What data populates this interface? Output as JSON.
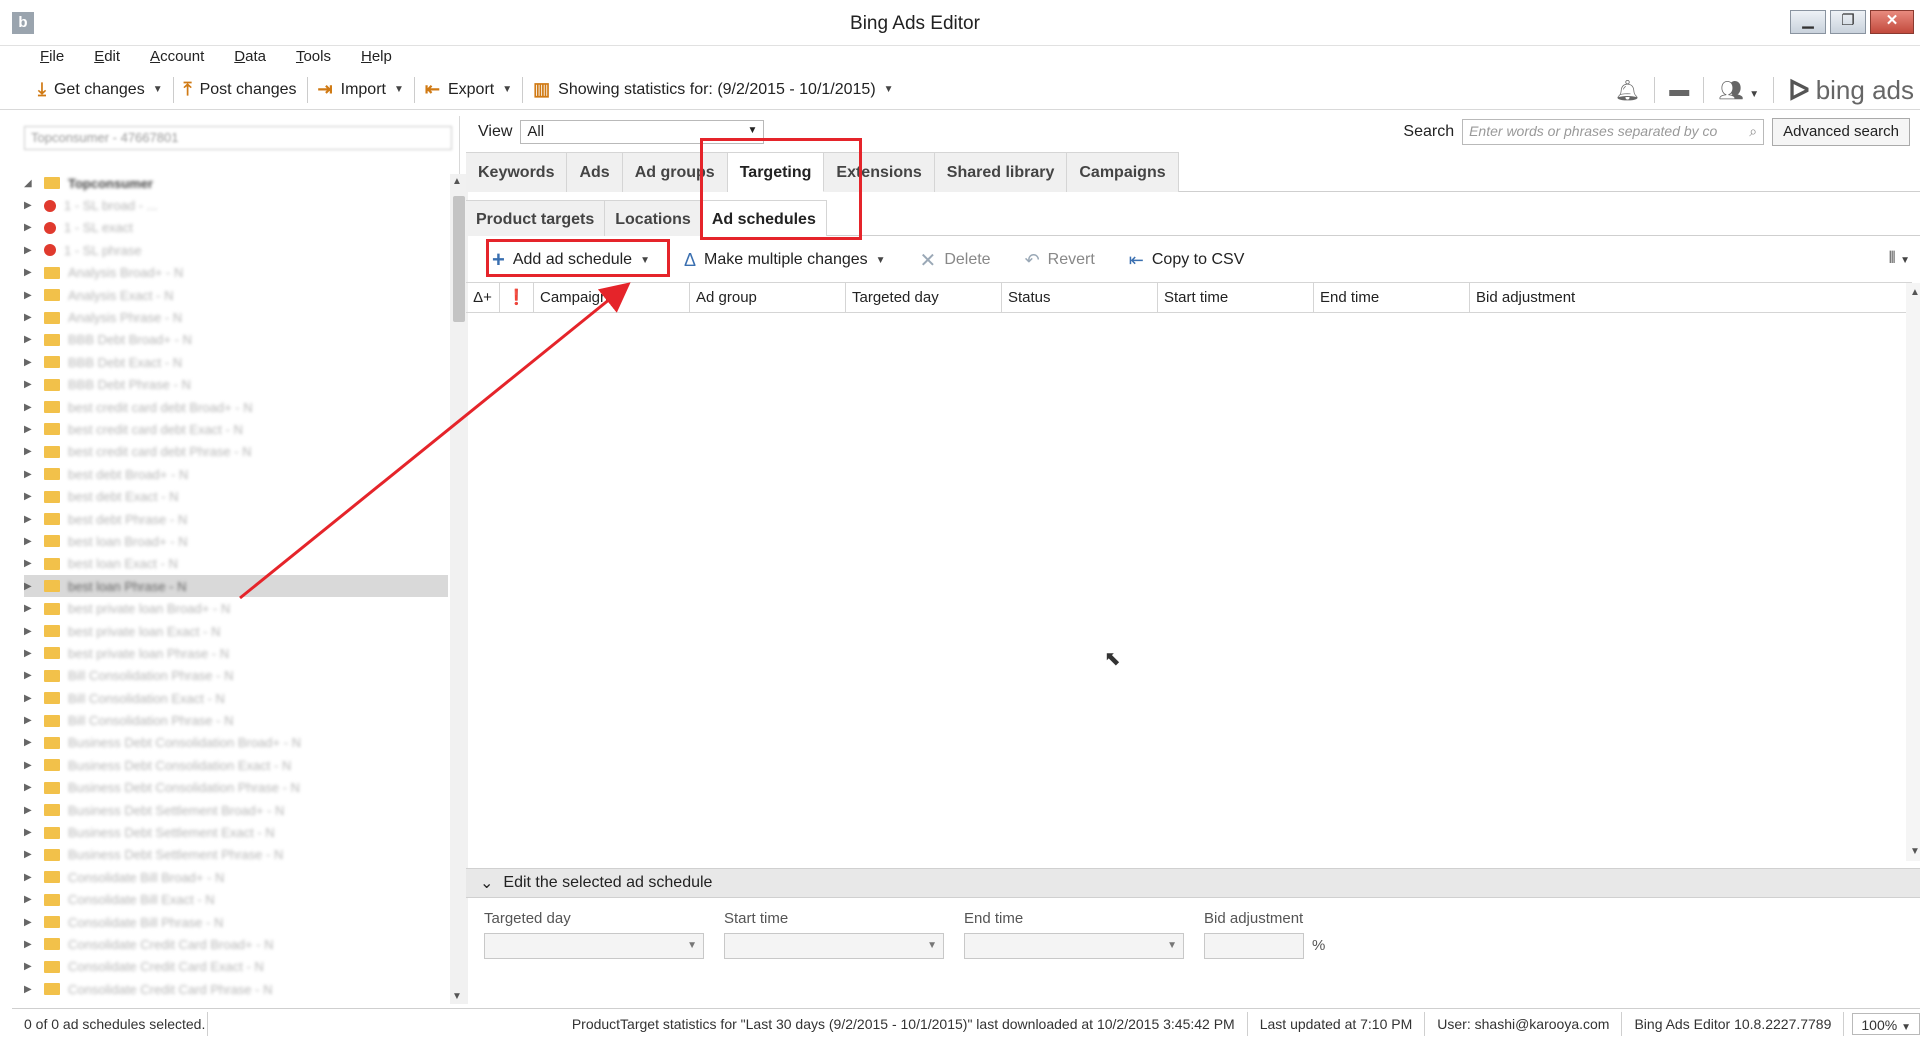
{
  "window": {
    "title": "Bing Ads Editor",
    "logo": "b"
  },
  "menu": [
    {
      "pre": "",
      "u": "F",
      "post": "ile"
    },
    {
      "pre": "",
      "u": "E",
      "post": "dit"
    },
    {
      "pre": "",
      "u": "A",
      "post": "ccount"
    },
    {
      "pre": "",
      "u": "D",
      "post": "ata"
    },
    {
      "pre": "",
      "u": "T",
      "post": "ools"
    },
    {
      "pre": "",
      "u": "H",
      "post": "elp"
    }
  ],
  "toolbar": {
    "get_changes": "Get changes",
    "post_changes": "Post changes",
    "import": "Import",
    "export": "Export",
    "stats": "Showing statistics for: (9/2/2015 - 10/1/2015)",
    "brand": "bing ads"
  },
  "left": {
    "account_field": "Topconsumer - 47667801",
    "root": "Topconsumer",
    "tree": [
      "1 - SL broad - ...",
      "1 - SL exact",
      "1 - SL phrase",
      "Analysis Broad+ - N",
      "Analysis Exact - N",
      "Analysis Phrase - N",
      "BBB Debt Broad+ - N",
      "BBB Debt Exact - N",
      "BBB Debt Phrase - N",
      "best credit card debt Broad+ - N",
      "best credit card debt Exact - N",
      "best credit card debt Phrase - N",
      "best debt Broad+ - N",
      "best debt Exact - N",
      "best debt Phrase - N",
      "best loan Broad+ - N",
      "best loan Exact - N",
      "best loan Phrase - N",
      "best private loan Broad+ - N",
      "best private loan Exact - N",
      "best private loan Phrase - N",
      "Bill Consolidation Phrase - N",
      "Bill Consolidation Exact - N",
      "Bill Consolidation Phrase - N",
      "Business Debt Consolidation Broad+ - N",
      "Business Debt Consolidation Exact - N",
      "Business Debt Consolidation Phrase - N",
      "Business Debt Settlement Broad+ - N",
      "Business Debt Settlement Exact - N",
      "Business Debt Settlement Phrase - N",
      "Consolidate Bill Broad+ - N",
      "Consolidate Bill Exact - N",
      "Consolidate Bill Phrase - N",
      "Consolidate Credit Card Broad+ - N",
      "Consolidate Credit Card Exact - N",
      "Consolidate Credit Card Phrase - N"
    ]
  },
  "main": {
    "view_label": "View",
    "view_value": "All",
    "search_label": "Search",
    "search_placeholder": "Enter words or phrases separated by co",
    "advanced_search": "Advanced search",
    "tabs": [
      "Keywords",
      "Ads",
      "Ad groups",
      "Targeting",
      "Extensions",
      "Shared library",
      "Campaigns"
    ],
    "subtabs": [
      "Product targets",
      "Locations",
      "Ad schedules"
    ],
    "actions": {
      "add": "Add ad schedule",
      "multi": "Make multiple changes",
      "delete": "Delete",
      "revert": "Revert",
      "csv": "Copy to CSV"
    },
    "columns": [
      "Campaign",
      "Ad group",
      "Targeted day",
      "Status",
      "Start time",
      "End time",
      "Bid adjustment"
    ],
    "edit_header": "Edit the selected ad schedule",
    "edit_fields": {
      "day": "Targeted day",
      "start": "Start time",
      "end": "End time",
      "bid": "Bid adjustment",
      "pct": "%"
    }
  },
  "status": {
    "selected": "0 of 0 ad schedules selected.",
    "stats": "ProductTarget statistics for \"Last 30 days (9/2/2015 - 10/1/2015)\" last downloaded at 10/2/2015 3:45:42 PM",
    "updated": "Last updated at 7:10 PM",
    "user": "User: shashi@karooya.com",
    "version": "Bing Ads Editor 10.8.2227.7789",
    "zoom": "100%"
  },
  "colors": {
    "annotation": "#e5242a",
    "accent": "#3a6fb0"
  }
}
